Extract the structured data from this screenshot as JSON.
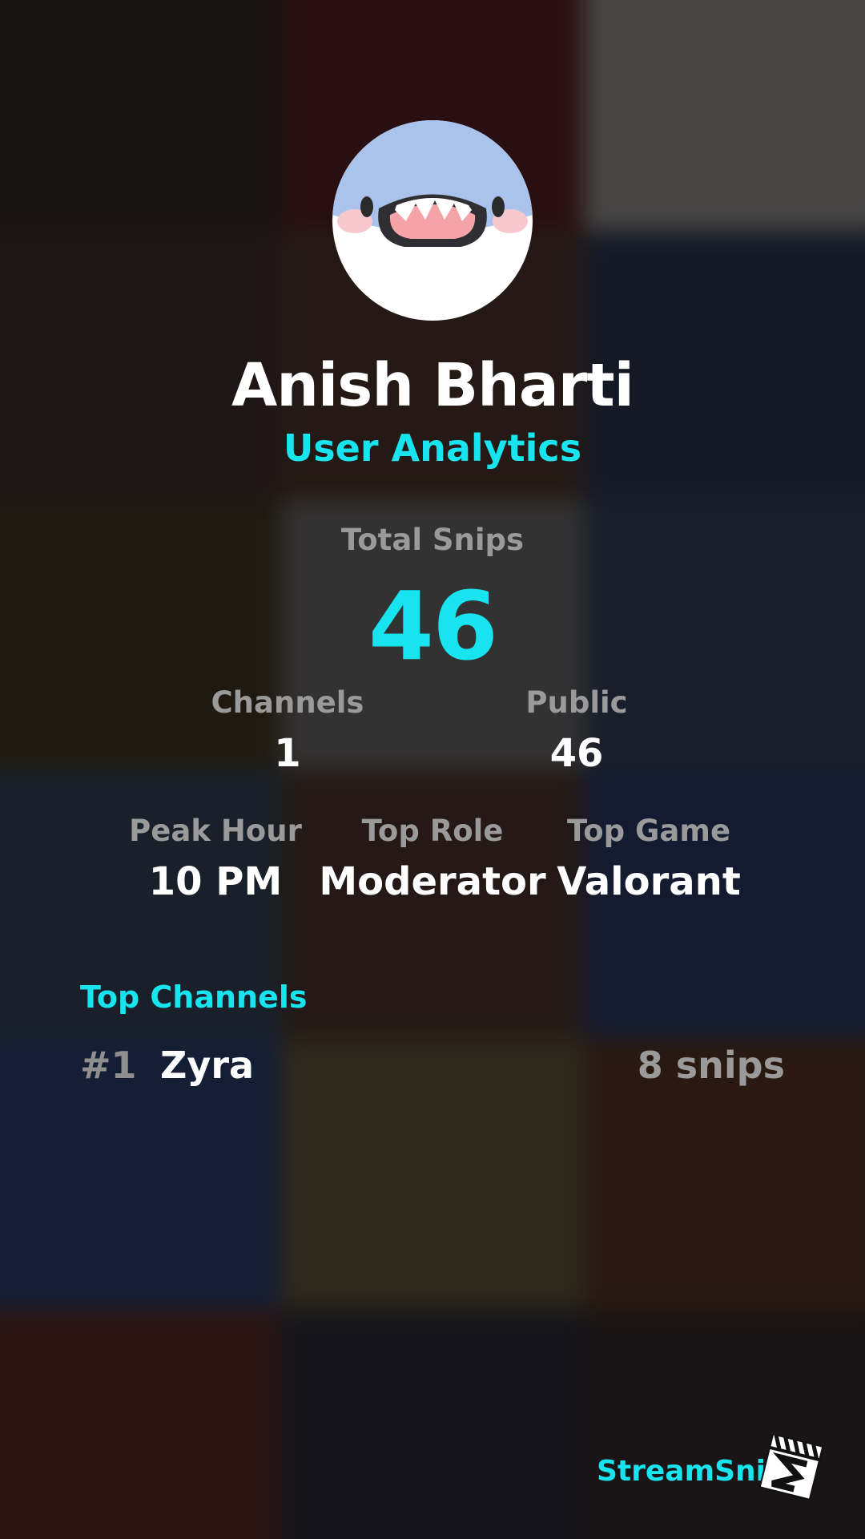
{
  "profile": {
    "name": "Anish Bharti",
    "subtitle": "User Analytics"
  },
  "stats": {
    "total_snips_label": "Total Snips",
    "total_snips_value": "46",
    "channels_label": "Channels",
    "channels_value": "1",
    "public_label": "Public",
    "public_value": "46",
    "peak_hour_label": "Peak Hour",
    "peak_hour_value": "10 PM",
    "top_role_label": "Top Role",
    "top_role_value": "Moderator",
    "top_game_label": "Top Game",
    "top_game_value": "Valorant"
  },
  "top_channels": {
    "title": "Top Channels",
    "items": [
      {
        "rank": "#1",
        "name": "Zyra",
        "count": "8 snips"
      }
    ]
  },
  "footer": {
    "brand": "StreamSnip"
  },
  "colors": {
    "accent": "#18e4f0",
    "muted": "#9a9a9a",
    "text": "#ffffff"
  }
}
